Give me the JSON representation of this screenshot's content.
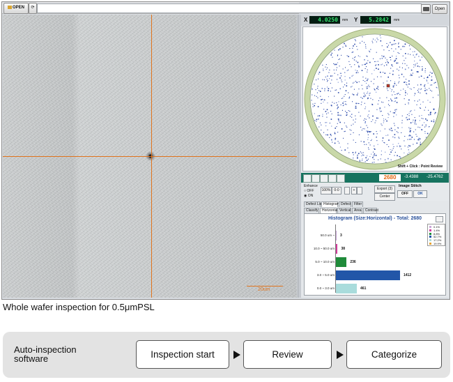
{
  "toolbar": {
    "open_label": "OPEN",
    "open_right_label": "Open"
  },
  "coords": {
    "x_label": "X",
    "x_value": "4.0250",
    "x_unit": "mm",
    "y_label": "Y",
    "y_value": "5.2842",
    "y_unit": "mm"
  },
  "map": {
    "caption": "Shift + Click : Point Review"
  },
  "control_strip": {
    "count": "2680",
    "coord_x": "-3.4388",
    "coord_y": "-25.4762"
  },
  "options": {
    "enhance_label": "Enhance",
    "off_label": "OFF",
    "on_label": "ON",
    "zoom_value": "100%",
    "image_stitch_label": "Image Stitch",
    "stitch_off": "OFF",
    "stitch_ok": "OK",
    "center_label": "Center",
    "export_label": "Export (3)"
  },
  "tabs_top": [
    "Defect List",
    "Histogram",
    "Defect",
    "Filter"
  ],
  "tabs_sub": [
    "Classify",
    "Horizontal",
    "Vertical",
    "Area",
    "Contrast"
  ],
  "histogram": {
    "title": "Histogram (Size:Horizontal) - Total: 2680",
    "categories": [
      "50.0 um ~",
      "10.0 ~ 50.0 um",
      "5.0 ~ 10.0 um",
      "3.0 ~ 5.0 um",
      "0.0 ~ 3.0 um"
    ],
    "values": [
      3,
      38,
      236,
      1412,
      461
    ],
    "colors": [
      "#c9a6d8",
      "#d23b9b",
      "#1f8b3a",
      "#2256a8",
      "#a9dcdc"
    ],
    "legend": [
      {
        "label": "0.1%",
        "color": "#c9a6d8"
      },
      {
        "label": "1.4%",
        "color": "#d23b9b"
      },
      {
        "label": "8.8%",
        "color": "#1f8b3a"
      },
      {
        "label": "52.7%",
        "color": "#2256a8"
      },
      {
        "label": "17.2%",
        "color": "#a9dcdc"
      },
      {
        "label": "19.9%",
        "color": "#e6a234"
      }
    ]
  },
  "sem": {
    "scale_label": "20um"
  },
  "caption": "Whole wafer inspection for 0.5μmPSL",
  "flow": {
    "title_line1": "Auto-inspection",
    "title_line2": "software",
    "steps": [
      "Inspection start",
      "Review",
      "Categorize"
    ]
  }
}
